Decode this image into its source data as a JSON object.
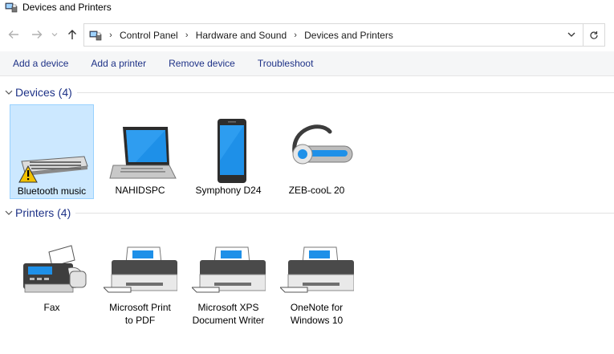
{
  "window": {
    "title": "Devices and Printers"
  },
  "address": {
    "crumbs": [
      "Control Panel",
      "Hardware and Sound",
      "Devices and Printers"
    ]
  },
  "commands": [
    "Add a device",
    "Add a printer",
    "Remove device",
    "Troubleshoot"
  ],
  "devices": {
    "title": "Devices",
    "count": "(4)",
    "items": [
      {
        "label": "Bluetooth music",
        "icon": "keyboard-warning-icon",
        "selected": true
      },
      {
        "label": "NAHIDSPC",
        "icon": "laptop-icon"
      },
      {
        "label": "Symphony D24",
        "icon": "smartphone-icon"
      },
      {
        "label": "ZEB-cooL 20",
        "icon": "bluetooth-headset-icon"
      }
    ]
  },
  "printers": {
    "title": "Printers",
    "count": "(4)",
    "items": [
      {
        "label_line1": "Fax",
        "label_line2": "",
        "icon": "fax-icon"
      },
      {
        "label_line1": "Microsoft Print",
        "label_line2": "to PDF",
        "icon": "printer-icon"
      },
      {
        "label_line1": "Microsoft XPS",
        "label_line2": "Document Writer",
        "icon": "printer-icon"
      },
      {
        "label_line1": "OneNote for",
        "label_line2": "Windows 10",
        "icon": "printer-icon"
      }
    ]
  },
  "colors": {
    "accent": "#1e3287",
    "selection": "#cce8ff",
    "selection_border": "#99d1ff",
    "screen_blue": "#1e90e8"
  }
}
